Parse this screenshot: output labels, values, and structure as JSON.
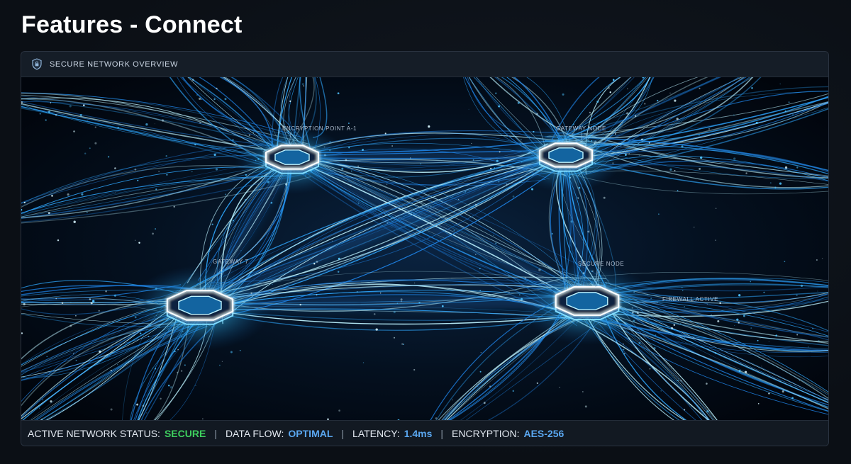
{
  "page": {
    "title": "Features - Connect"
  },
  "panel": {
    "title": "SECURE NETWORK OVERVIEW",
    "icon": "shield-icon"
  },
  "network": {
    "labels": {
      "encryption_point": "ENCRYPTION POINT A-1",
      "gateway_node": "GATEWAY NODE",
      "gateway_7": "GATEWAY 7",
      "secure_node": "SECURE NODE",
      "firewall": "FIREWALL ACTIVE"
    }
  },
  "status": {
    "network_label": "ACTIVE NETWORK STATUS:",
    "network_value": "SECURE",
    "flow_label": "DATA FLOW:",
    "flow_value": "OPTIMAL",
    "latency_label": "LATENCY:",
    "latency_value": "1.4ms",
    "encryption_label": "ENCRYPTION:",
    "encryption_value": "AES-256",
    "separator": "|"
  },
  "colors": {
    "secure": "#3ecf5e",
    "accent": "#5aa7f0",
    "glow": "#39c6ff"
  }
}
